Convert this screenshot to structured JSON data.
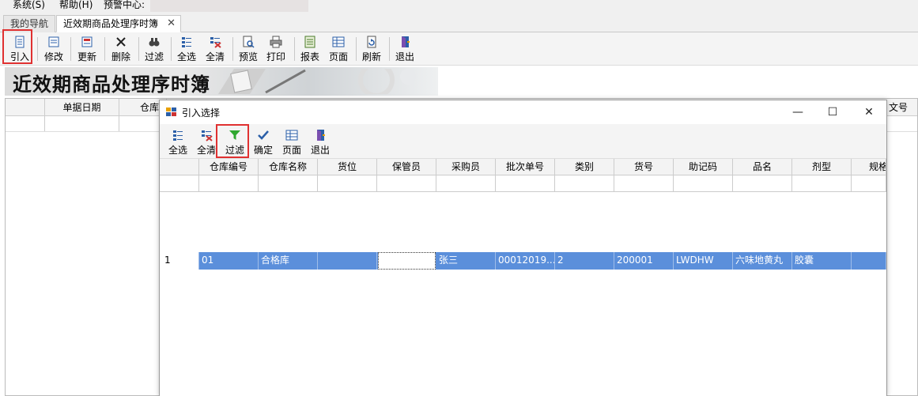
{
  "menu": {
    "items": [
      "系统(S)",
      "帮助(H)",
      "预警中心:"
    ]
  },
  "tabs": {
    "nav": "我的导航",
    "active": "近效期商品处理序时簿",
    "close": "✕"
  },
  "toolbar": {
    "import": "引入",
    "modify": "修改",
    "update": "更新",
    "delete": "删除",
    "filter": "过滤",
    "select_all": "全选",
    "clear_all": "全清",
    "preview": "预览",
    "print": "打印",
    "report": "报表",
    "page": "页面",
    "refresh": "刷新",
    "exit": "退出"
  },
  "banner": {
    "title": "近效期商品处理序时簿"
  },
  "main_grid": {
    "columns": [
      "单据日期",
      "仓库",
      "文号"
    ]
  },
  "dialog": {
    "title": "引入选择",
    "toolbar": {
      "select_all": "全选",
      "clear_all": "全清",
      "filter": "过滤",
      "confirm": "确定",
      "page": "页面",
      "exit": "退出"
    },
    "columns": [
      "仓库编号",
      "仓库名称",
      "货位",
      "保管员",
      "采购员",
      "批次单号",
      "类别",
      "货号",
      "助记码",
      "品名",
      "剂型",
      "规格"
    ],
    "rows": [
      {
        "num": "1",
        "cells": [
          "01",
          "合格库",
          "",
          "",
          "张三",
          "00012019...",
          "2",
          "200001",
          "LWDHW",
          "六味地黄丸",
          "胶囊",
          ""
        ]
      }
    ]
  },
  "colors": {
    "selection": "#5b8fdb",
    "highlight_box": "#e03131"
  }
}
